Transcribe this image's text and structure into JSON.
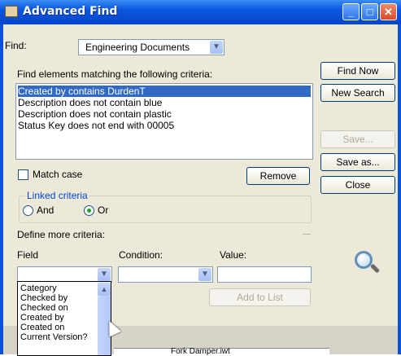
{
  "window": {
    "title": "Advanced Find",
    "buttons": [
      "minimize",
      "maximize",
      "close"
    ]
  },
  "find": {
    "label": "Find:",
    "value": "Engineering Documents"
  },
  "criteria": {
    "heading": "Find elements matching the following criteria:",
    "items": [
      "Created by contains DurdenT",
      "Description does not contain blue",
      "Description does not contain plastic",
      "Status Key does not end with 00005"
    ],
    "selected_index": 0
  },
  "buttons": {
    "find_now": "Find Now",
    "new_search": "New Search",
    "save": "Save...",
    "save_as": "Save as...",
    "close": "Close",
    "remove": "Remove",
    "add_to_list": "Add to List"
  },
  "match_case": {
    "label": "Match case",
    "checked": false
  },
  "linked": {
    "title": "Linked criteria",
    "and": "And",
    "or": "Or",
    "selected": "Or"
  },
  "define": {
    "heading": "Define more criteria:",
    "field_label": "Field",
    "condition_label": "Condition:",
    "value_label": "Value:",
    "field_value": "",
    "condition_value": "",
    "value_value": ""
  },
  "field_options": [
    "Category",
    "Checked by",
    "Checked on",
    "Created by",
    "Created on",
    "Current Version?"
  ],
  "background_peek": "Fork Damper.iwt",
  "icons": {
    "search": "magnifier-icon",
    "dropdown": "chevron-down-icon",
    "app": "app-icon"
  },
  "colors": {
    "titlebar": "#0a56e0",
    "selection": "#316ac5",
    "face": "#ece9d8"
  }
}
